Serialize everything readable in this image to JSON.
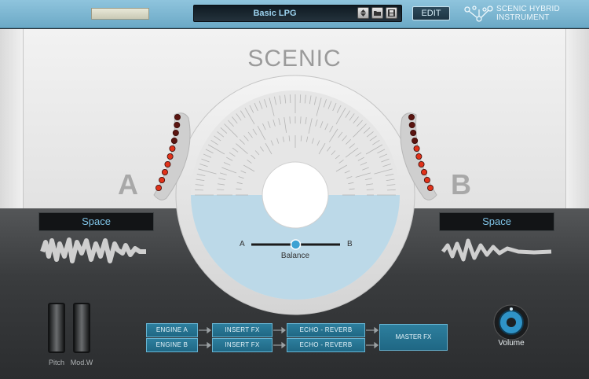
{
  "topbar": {
    "preset_name": "Basic LPG",
    "edit_label": "EDIT",
    "logo_line1": "SCENIC HYBRID",
    "logo_line2": "INSTRUMENT"
  },
  "main": {
    "title": "SCENIC",
    "side_a": "A",
    "side_b": "B",
    "preset_a": "Space",
    "preset_b": "Space",
    "balance": {
      "label": "Balance",
      "left": "A",
      "right": "B",
      "value": 0.5
    }
  },
  "controls": {
    "pitch_label": "Pitch",
    "modw_label": "Mod.W",
    "volume_label": "Volume"
  },
  "routing": {
    "engine_a": "ENGINE A",
    "engine_b": "ENGINE B",
    "insert_fx_a": "INSERT FX",
    "insert_fx_b": "INSERT FX",
    "echo_a": "ECHO - REVERB",
    "echo_b": "ECHO - REVERB",
    "master": "MASTER FX"
  },
  "colors": {
    "accent": "#7fc3e6",
    "led_on": "#e0321a",
    "led_dim": "#5a1410"
  },
  "meters": {
    "a_lit": 6,
    "b_lit": 6,
    "total": 10
  }
}
